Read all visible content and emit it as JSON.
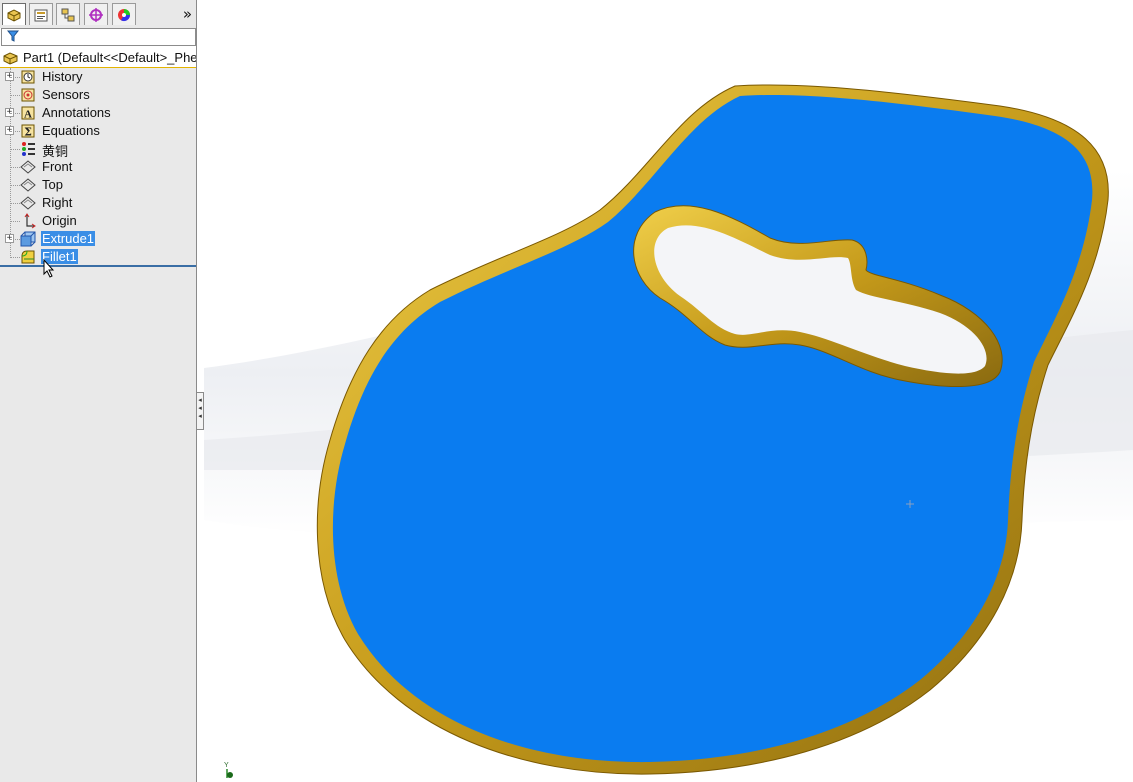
{
  "feature_tree": {
    "root_label": "Part1  (Default<<Default>_Phe",
    "items": [
      {
        "label": "History",
        "icon": "history-icon",
        "expandable": true
      },
      {
        "label": "Sensors",
        "icon": "sensors-icon",
        "expandable": false
      },
      {
        "label": "Annotations",
        "icon": "annotations-icon",
        "expandable": true
      },
      {
        "label": "Equations",
        "icon": "equations-icon",
        "expandable": true
      },
      {
        "label": "黄铜",
        "icon": "material-icon",
        "expandable": false
      },
      {
        "label": "Front",
        "icon": "plane-icon",
        "expandable": false
      },
      {
        "label": "Top",
        "icon": "plane-icon",
        "expandable": false
      },
      {
        "label": "Right",
        "icon": "plane-icon",
        "expandable": false
      },
      {
        "label": "Origin",
        "icon": "origin-icon",
        "expandable": false
      },
      {
        "label": "Extrude1",
        "icon": "extrude-icon",
        "expandable": true,
        "selected": true
      },
      {
        "label": "Fillet1",
        "icon": "fillet-icon",
        "expandable": false,
        "selected": true
      }
    ]
  },
  "tabs": [
    {
      "name": "featuremanager-tab",
      "icon": "featuremanager-icon",
      "active": true
    },
    {
      "name": "propertymanager-tab",
      "icon": "propertymanager-icon",
      "active": false
    },
    {
      "name": "configurationmanager-tab",
      "icon": "configuration-icon",
      "active": false
    },
    {
      "name": "dimxpert-tab",
      "icon": "dimxpert-icon",
      "active": false
    },
    {
      "name": "display-manager-tab",
      "icon": "appearance-icon",
      "active": false
    }
  ],
  "overflow_label": "»",
  "triad_label": "Y",
  "colors": {
    "face_blue": "#0a7cf0",
    "fillet_gold": "#c9a21c",
    "selection": "#3a8ee6",
    "highlight_bar": "#e4b400"
  }
}
